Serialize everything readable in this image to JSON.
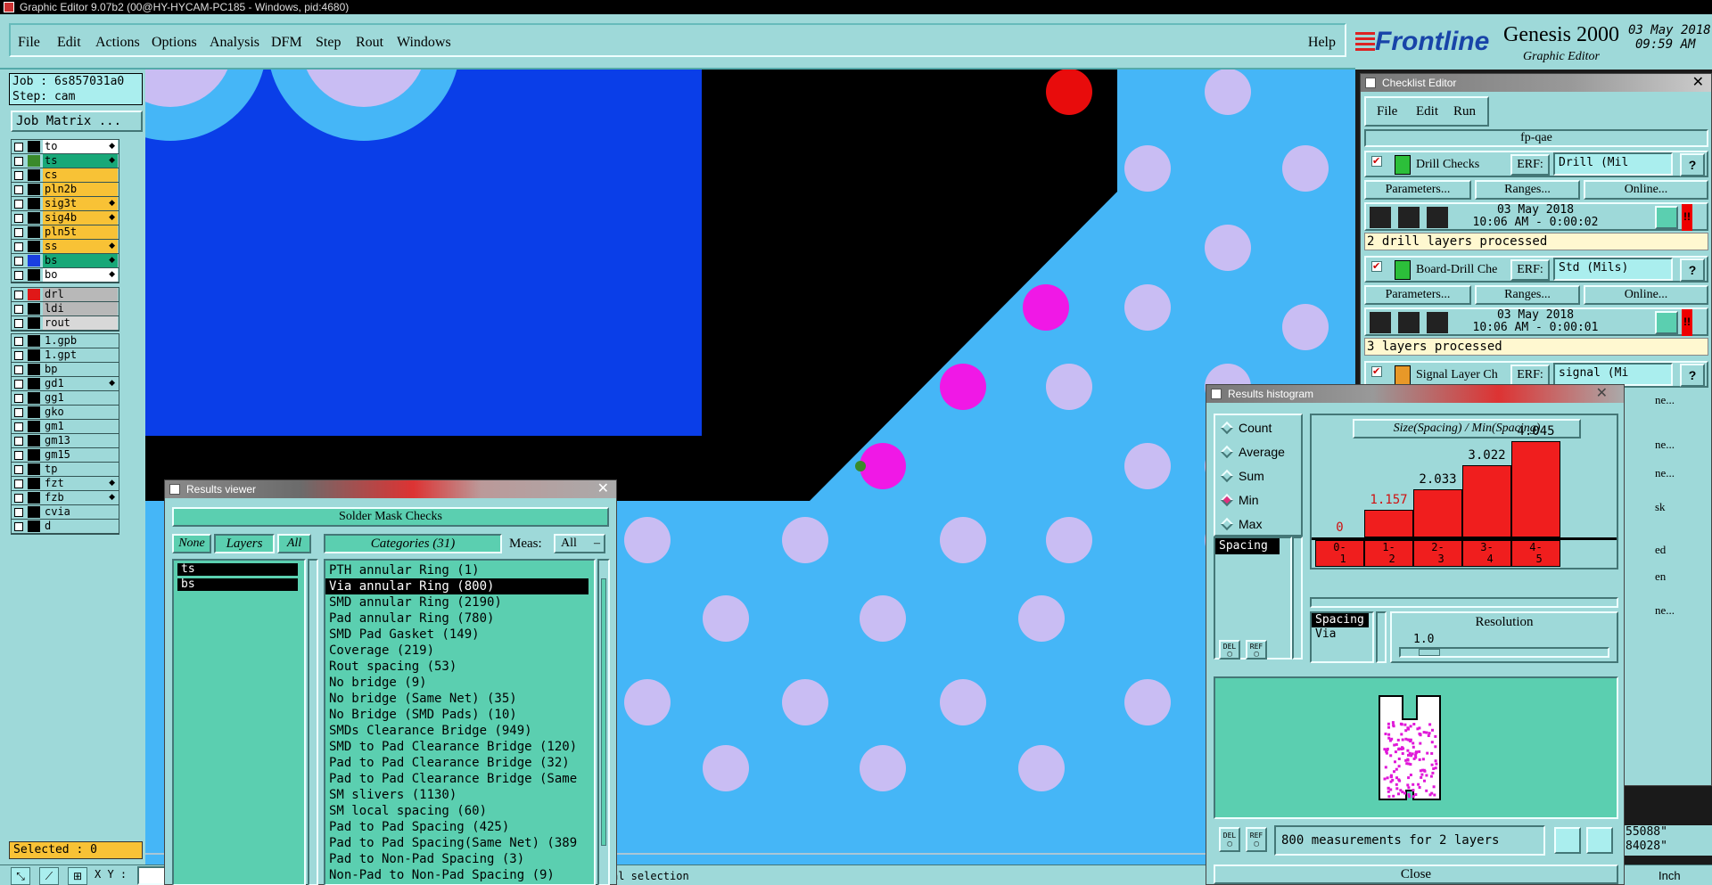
{
  "window": {
    "title": "Graphic Editor 9.07b2 (00@HY-HYCAM-PC185 - Windows, pid:4680)"
  },
  "menu": {
    "items": [
      "File",
      "Edit",
      "Actions",
      "Options",
      "Analysis",
      "DFM",
      "Step",
      "Rout",
      "Windows"
    ],
    "help": "Help"
  },
  "brand": {
    "logo": "Frontline",
    "product": "Genesis 2000",
    "subtitle": "Graphic Editor",
    "date": "03 May 2018",
    "time": "09:59 AM"
  },
  "job": {
    "job": "Job : 6s857031a0",
    "step": "Step: cam",
    "matrix_button": "Job Matrix ..."
  },
  "layers": {
    "group1": [
      {
        "name": "to",
        "color": "#ffffff",
        "swatch": "#000000",
        "flag": "◆"
      },
      {
        "name": "ts",
        "color": "#18a878",
        "swatch": "#3a8a2a",
        "flag": "◆"
      },
      {
        "name": "cs",
        "color": "#f8c236",
        "swatch": "#000000",
        "flag": ""
      },
      {
        "name": "pln2b",
        "color": "#f8c236",
        "swatch": "#000000",
        "flag": ""
      },
      {
        "name": "sig3t",
        "color": "#f8c236",
        "swatch": "#000000",
        "flag": "◆"
      },
      {
        "name": "sig4b",
        "color": "#f8c236",
        "swatch": "#000000",
        "flag": "◆"
      },
      {
        "name": "pln5t",
        "color": "#f8c236",
        "swatch": "#000000",
        "flag": ""
      },
      {
        "name": "ss",
        "color": "#f8c236",
        "swatch": "#000000",
        "flag": "◆"
      },
      {
        "name": "bs",
        "color": "#18a878",
        "swatch": "#1a3fe0",
        "flag": "◆"
      },
      {
        "name": "bo",
        "color": "#ffffff",
        "swatch": "#000000",
        "flag": "◆"
      }
    ],
    "group2": [
      {
        "name": "drl",
        "color": "#b8b8b8",
        "swatch": "#e01818",
        "flag": ""
      },
      {
        "name": "ldi",
        "color": "#b8b8b8",
        "swatch": "#000000",
        "flag": ""
      },
      {
        "name": "rout",
        "color": "#d8d8d8",
        "swatch": "#000000",
        "flag": ""
      }
    ],
    "group3": [
      {
        "name": "1.gpb",
        "color": "#9ed9d9",
        "swatch": "#000000",
        "flag": ""
      },
      {
        "name": "1.gpt",
        "color": "#9ed9d9",
        "swatch": "#000000",
        "flag": ""
      },
      {
        "name": "bp",
        "color": "#9ed9d9",
        "swatch": "#000000",
        "flag": ""
      },
      {
        "name": "gd1",
        "color": "#9ed9d9",
        "swatch": "#000000",
        "flag": "◆"
      },
      {
        "name": "gg1",
        "color": "#9ed9d9",
        "swatch": "#000000",
        "flag": ""
      },
      {
        "name": "gko",
        "color": "#9ed9d9",
        "swatch": "#000000",
        "flag": ""
      },
      {
        "name": "gm1",
        "color": "#9ed9d9",
        "swatch": "#000000",
        "flag": ""
      },
      {
        "name": "gm13",
        "color": "#9ed9d9",
        "swatch": "#000000",
        "flag": ""
      },
      {
        "name": "gm15",
        "color": "#9ed9d9",
        "swatch": "#000000",
        "flag": ""
      },
      {
        "name": "tp",
        "color": "#9ed9d9",
        "swatch": "#000000",
        "flag": ""
      },
      {
        "name": "fzt",
        "color": "#9ed9d9",
        "swatch": "#000000",
        "flag": "◆"
      },
      {
        "name": "fzb",
        "color": "#9ed9d9",
        "swatch": "#000000",
        "flag": "◆"
      },
      {
        "name": "cvia",
        "color": "#9ed9d9",
        "swatch": "#000000",
        "flag": ""
      },
      {
        "name": "d",
        "color": "#9ed9d9",
        "swatch": "#000000",
        "flag": ""
      }
    ]
  },
  "status": {
    "selected": "Selected : 0",
    "xy_label": "X Y :",
    "message": "al selection",
    "units": "Inch",
    "coord1": "55088\"",
    "coord2": "84028\""
  },
  "results_viewer": {
    "title": "Results viewer",
    "heading": "Solder Mask Checks",
    "none_btn": "None",
    "layers_btn": "Layers",
    "all_btn": "All",
    "categories_btn": "Categories (31)",
    "meas_label": "Meas:",
    "meas_value": "All",
    "layers": [
      "ts",
      "bs"
    ],
    "categories": [
      "PTH annular Ring (1)",
      "Via annular Ring (800)",
      "SMD annular Ring (2190)",
      "Pad annular Ring (780)",
      "SMD Pad Gasket (149)",
      "Coverage (219)",
      "Rout spacing (53)",
      "No bridge (9)",
      "No bridge (Same Net) (35)",
      "No Bridge (SMD Pads) (10)",
      "SMDs Clearance Bridge (949)",
      "SMD to Pad Clearance Bridge (120)",
      "Pad to Pad Clearance Bridge (32)",
      "Pad to Pad Clearance Bridge (Same",
      "SM slivers (1130)",
      "SM local spacing (60)",
      "Pad to Pad Spacing (425)",
      "Pad to Pad Spacing(Same Net) (389",
      "Pad to Non-Pad Spacing (3)",
      "Non-Pad to Non-Pad Spacing (9)"
    ]
  },
  "checklist": {
    "title": "Checklist Editor",
    "menu": [
      "File",
      "Edit",
      "Run"
    ],
    "name": "fp-qae",
    "checks": [
      {
        "name": "Drill Checks",
        "erf": "ERF:",
        "erf_value": "Drill (Mil",
        "date": "03 May 2018",
        "time": "10:06 AM - 0:00:02",
        "result": "2 drill layers processed"
      },
      {
        "name": "Board-Drill Che",
        "erf": "ERF:",
        "erf_value": "Std (Mils)",
        "date": "03 May 2018",
        "time": "10:06 AM - 0:00:01",
        "result": "3 layers processed"
      },
      {
        "name": "Signal Layer Ch",
        "erf": "ERF:",
        "erf_value": "signal (Mi",
        "date": "",
        "time": "",
        "result": ""
      }
    ],
    "params_btn": "Parameters...",
    "ranges_btn": "Ranges...",
    "online_btn": "Online...",
    "peek": [
      "ne...",
      "ne...",
      "ne...",
      "sk",
      "ed",
      "en",
      "ne..."
    ]
  },
  "histogram": {
    "title": "Results histogram",
    "modes": [
      {
        "label": "Count",
        "on": false
      },
      {
        "label": "Average",
        "on": false
      },
      {
        "label": "Sum",
        "on": false
      },
      {
        "label": "Min",
        "on": true
      },
      {
        "label": "Max",
        "on": false
      }
    ],
    "list1": [
      "Spacing"
    ],
    "list2": [
      "Spacing",
      "Via"
    ],
    "resolution_label": "Resolution",
    "resolution_value": "1.0",
    "summary": "800 measurements for 2 layers",
    "close": "Close",
    "del": "DEL",
    "ref": "REF"
  },
  "chart_data": {
    "type": "bar",
    "title": "Size(Spacing) / Min(Spacing)",
    "categories": [
      "0-1",
      "1-2",
      "2-3",
      "3-4",
      "4-5"
    ],
    "values": [
      0,
      1.157,
      2.033,
      3.022,
      4.045
    ],
    "value_labels": [
      "0",
      "1.157",
      "2.033",
      "3.022",
      "4.045"
    ],
    "ylim": [
      0,
      4.5
    ],
    "grid": false,
    "colors": {
      "bar": "#f01e1e",
      "first_label": "#d01010"
    }
  },
  "colors": {
    "canvas": "#45b6f7",
    "pad_light": "#c9bdf3",
    "pad_magenta": "#f018e6",
    "red_pad": "#e80c0c",
    "copper": "#0a3ee8",
    "void": "#000000",
    "panel": "#9ed9d9"
  }
}
